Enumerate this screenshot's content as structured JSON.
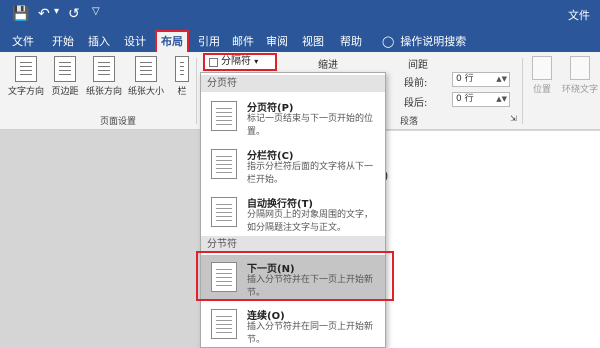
{
  "titlebar": {
    "save_icon": "save-icon",
    "undo_icon": "undo-icon",
    "redo_icon": "redo-icon",
    "customize_icon": "customize-icon",
    "file_name": "文件"
  },
  "tabs": [
    "文件",
    "开始",
    "插入",
    "设计",
    "布局",
    "引用",
    "邮件",
    "审阅",
    "视图",
    "帮助"
  ],
  "tell_me": "操作说明搜索",
  "ribbon": {
    "buttons": [
      "文字方向",
      "页边距",
      "纸张方向",
      "纸张大小",
      "栏"
    ],
    "group_label": "页面设置",
    "separator_dropdown": "分隔符",
    "indent_label": "缩进",
    "spacing_label": "间距",
    "before_label": "段前:",
    "before_value": "0 行",
    "after_label": "段后:",
    "after_value": "0 行",
    "paragraph_label": "段落",
    "position_label": "位置",
    "wrap_label": "环绕文字"
  },
  "menu": {
    "section_page": "分页符",
    "items_page": [
      {
        "title": "分页符(P)",
        "desc": "标记一页结束与下一页开始的位置。"
      },
      {
        "title": "分栏符(C)",
        "desc": "指示分栏符后面的文字将从下一栏开始。"
      },
      {
        "title": "自动换行符(T)",
        "desc": "分隔网页上的对象周围的文字，如分隔题注文字与正文。"
      }
    ],
    "section_section": "分节符",
    "items_section": [
      {
        "title": "下一页(N)",
        "desc": "插入分节符并在下一页上开始新节。"
      },
      {
        "title": "连续(O)",
        "desc": "插入分节符并在同一页上开始新节。"
      }
    ]
  },
  "document": {
    "visible_mark": "0"
  },
  "colors": {
    "ribbon_blue": "#2b579a",
    "highlight_red": "#e0202a"
  }
}
